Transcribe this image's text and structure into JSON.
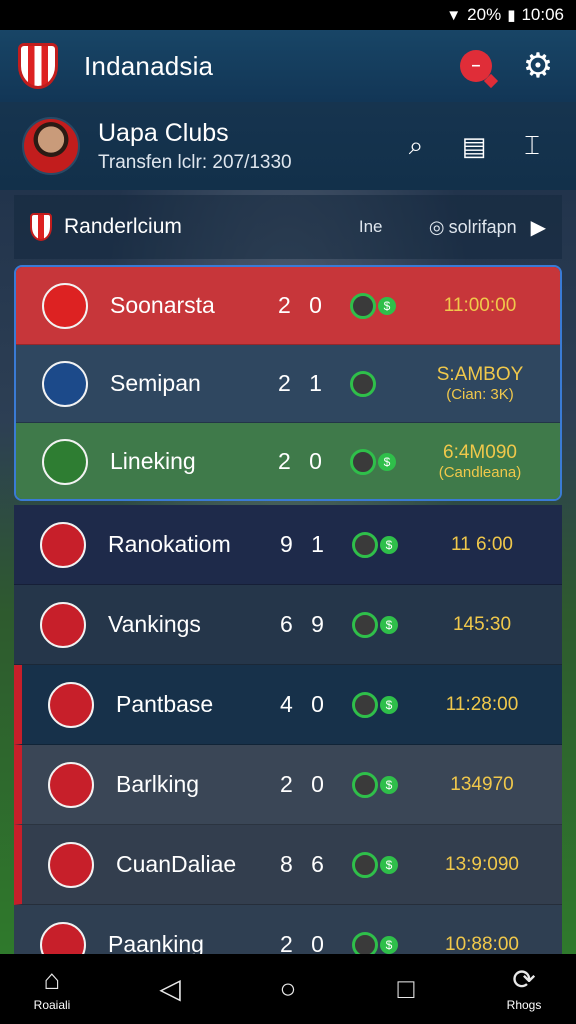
{
  "status_bar": {
    "battery": "20%",
    "time": "10:06"
  },
  "header": {
    "title": "Indanadsia"
  },
  "profile": {
    "name": "Uapa Clubs",
    "subtitle": "Transfen lclr: 207/1330"
  },
  "section": {
    "title": "Randerlcium",
    "col_label": "Ine",
    "filter_label": "solrifapn"
  },
  "rows_top": [
    {
      "name": "Soonarsta",
      "score": "2 0",
      "time": "11:00:00",
      "sub": "",
      "bg": "#c7363a",
      "badge": "#d22"
    },
    {
      "name": "Semipan",
      "score": "2 1",
      "time": "S:AMBOY",
      "sub": "(Cian: 3K)",
      "bg": "#2f4760",
      "badge": "#1c4a8a"
    },
    {
      "name": "Lineking",
      "score": "2 0",
      "time": "6:4M090",
      "sub": "(Candleana)",
      "bg": "#3f7a4a",
      "badge": "#2e7d32"
    }
  ],
  "rows_rest": [
    {
      "name": "Ranokatiom",
      "score": "9 1",
      "time": "11 6:00",
      "bg": "#1e2a4a",
      "red": false
    },
    {
      "name": "Vankings",
      "score": "6 9",
      "time": "145:30",
      "bg": "#25364a",
      "red": false
    },
    {
      "name": "Pantbase",
      "score": "4 0",
      "time": "11:28:00",
      "bg": "#17314a",
      "red": true
    },
    {
      "name": "Barlking",
      "score": "2 0",
      "time": "134970",
      "bg": "#3a4656",
      "red": true
    },
    {
      "name": "CuanDaliae",
      "score": "8 6",
      "time": "13:9:090",
      "bg": "#333e4e",
      "red": true
    },
    {
      "name": "Paanking",
      "score": "2 0",
      "time": "10:88:00",
      "bg": "#2f3f52",
      "red": false
    }
  ],
  "nav": {
    "home_label": "Roaiali",
    "right_label": "Rhogs"
  }
}
